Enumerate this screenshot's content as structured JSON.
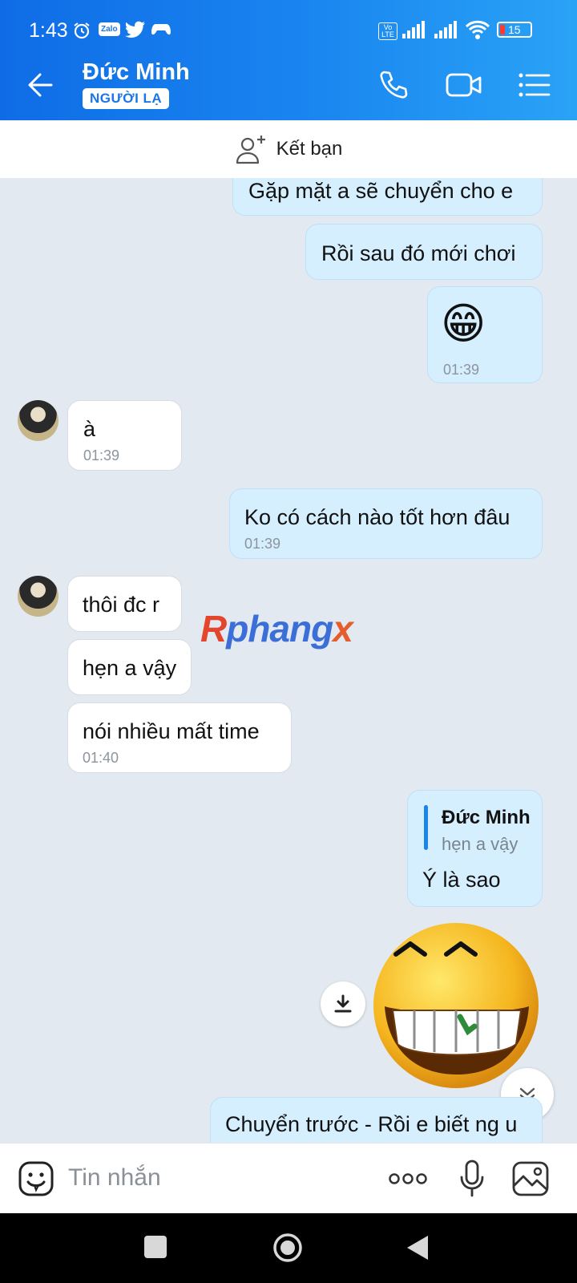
{
  "status": {
    "time": "1:43",
    "battery": "15",
    "zalo_label": "Zalo",
    "volte": "Vo LTE"
  },
  "header": {
    "contact_name": "Đức Minh",
    "badge": "NGƯỜI LẠ"
  },
  "friend_bar": {
    "label": "Kết bạn"
  },
  "watermark": {
    "part1": "R",
    "part2": "phang",
    "part3": "x"
  },
  "messages": {
    "m1": {
      "text": "Gặp mặt a sẽ chuyển cho e"
    },
    "m2": {
      "text": "Rồi sau đó mới chơi"
    },
    "m3": {
      "emoji": "😁",
      "time": "01:39"
    },
    "m4": {
      "text": "à",
      "time": "01:39"
    },
    "m5": {
      "text": "Ko có cách nào tốt hơn đâu",
      "time": "01:39"
    },
    "m6": {
      "text": "thôi đc r"
    },
    "m7": {
      "text": "hẹn a vậy"
    },
    "m8": {
      "text": "nói nhiều mất time",
      "time": "01:40"
    },
    "m9": {
      "quote_author": "Đức Minh",
      "quote_text": "hẹn a vậy",
      "text": "Ý là sao"
    },
    "m10": {
      "text": "Chuyển trước - Rồi e biết ng u"
    }
  },
  "input": {
    "placeholder": "Tin nhắn"
  },
  "icons": {
    "back": "arrow-left-icon",
    "call": "phone-icon",
    "video": "video-icon",
    "menu": "list-icon",
    "add_friend": "add-user-icon",
    "sticker": "emoji-icon",
    "more": "more-dots-icon",
    "mic": "microphone-icon",
    "image": "gallery-icon",
    "download": "download-icon",
    "scroll": "chevron-down-icon"
  },
  "colors": {
    "header_start": "#0f6ce6",
    "header_end": "#2aa3f6",
    "my_bubble": "#d5efff",
    "their_bubble": "#ffffff",
    "chat_bg": "#e2e9f1"
  }
}
